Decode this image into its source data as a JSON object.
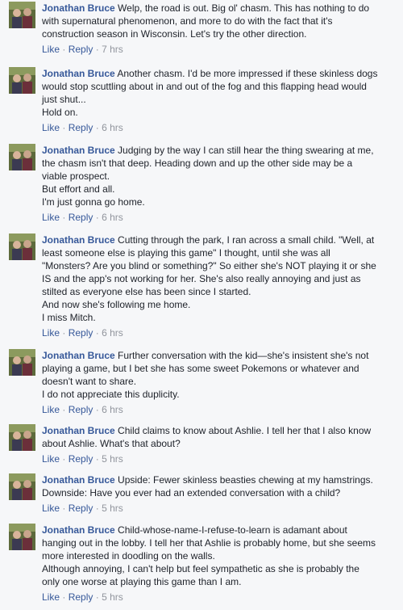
{
  "comments": [
    {
      "author": "Jonathan Bruce",
      "first_line": "Welp, the road is out. Big ol' chasm. This has nothing to do",
      "lines": [
        "with supernatural phenomenon, and more to do with the fact that it's",
        "construction season in Wisconsin. Let's try the other direction."
      ],
      "like": "Like",
      "reply": "Reply",
      "time": "7 hrs"
    },
    {
      "author": "Jonathan Bruce",
      "first_line": "Another chasm. I'd be more impressed if these skinless dogs",
      "lines": [
        "would stop scuttling about in and out of the fog and this flapping head would",
        "just shut...",
        "Hold on."
      ],
      "like": "Like",
      "reply": "Reply",
      "time": "6 hrs"
    },
    {
      "author": "Jonathan Bruce",
      "first_line": "Judging by the way I can still hear the thing swearing at me,",
      "lines": [
        "the chasm isn't that deep. Heading down and up the other side may be a",
        "viable prospect.",
        "But effort and all.",
        "I'm just gonna go home."
      ],
      "like": "Like",
      "reply": "Reply",
      "time": "6 hrs"
    },
    {
      "author": "Jonathan Bruce",
      "first_line": "Cutting through the park, I ran across a small child. \"Well, at",
      "lines": [
        "least someone else is playing this game\" I thought, until she was all",
        "\"Monsters? Are you blind or something?\" So either she's NOT playing it or she",
        "IS and the app's not working for her. She's also really annoying and just as",
        "stilted as everyone else has been since I started.",
        "And now she's following me home.",
        "I miss Mitch."
      ],
      "like": "Like",
      "reply": "Reply",
      "time": "6 hrs"
    },
    {
      "author": "Jonathan Bruce",
      "first_line": "Further conversation with the kid—she's insistent she's not",
      "lines": [
        "playing a game, but I bet she has some sweet Pokemons or whatever and",
        "doesn't want to share.",
        "I do not appreciate this duplicity."
      ],
      "like": "Like",
      "reply": "Reply",
      "time": "6 hrs"
    },
    {
      "author": "Jonathan Bruce",
      "first_line": "Child claims to know about Ashlie. I tell her that I also know",
      "lines": [
        "about Ashlie. What's that about?"
      ],
      "like": "Like",
      "reply": "Reply",
      "time": "5 hrs"
    },
    {
      "author": "Jonathan Bruce",
      "first_line": "Upside: Fewer skinless beasties chewing at my hamstrings.",
      "lines": [
        "Downside: Have you ever had an extended conversation with a child?"
      ],
      "like": "Like",
      "reply": "Reply",
      "time": "5 hrs"
    },
    {
      "author": "Jonathan Bruce",
      "first_line": "Child-whose-name-I-refuse-to-learn is adamant about",
      "lines": [
        "hanging out in the lobby. I tell her that Ashlie is probably home, but she seems",
        "more interested in doodling on the walls.",
        "Although annoying, I can't help but feel sympathetic as she is probably the",
        "only one worse at playing this game than I am."
      ],
      "like": "Like",
      "reply": "Reply",
      "time": "5 hrs"
    }
  ]
}
